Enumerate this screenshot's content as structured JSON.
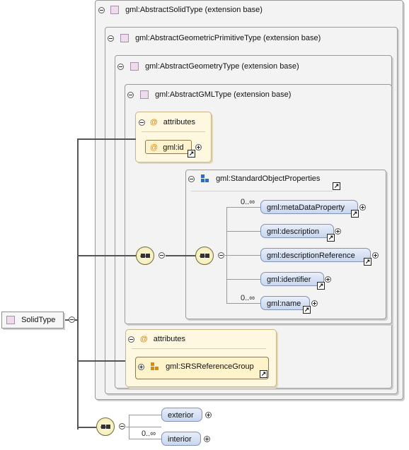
{
  "frames": {
    "solid": "gml:AbstractSolidType (extension base)",
    "primitive": "gml:AbstractGeometricPrimitiveType (extension base)",
    "geometry": "gml:AbstractGeometryType (extension base)",
    "gml": "gml:AbstractGMLType (extension base)"
  },
  "attributes_label": "attributes",
  "gml_id": "gml:id",
  "standard_object_properties": "gml:StandardObjectProperties",
  "properties": [
    {
      "name": "gml:metaDataProperty",
      "card": "0..∞"
    },
    {
      "name": "gml:description",
      "card": ""
    },
    {
      "name": "gml:descriptionReference",
      "card": ""
    },
    {
      "name": "gml:identifier",
      "card": ""
    },
    {
      "name": "gml:name",
      "card": "0..∞"
    }
  ],
  "attributes2_label": "attributes",
  "srs_group": "gml:SRSReferenceGroup",
  "root": "SolidType",
  "children": [
    {
      "name": "exterior",
      "card": ""
    },
    {
      "name": "interior",
      "card": "0..∞"
    }
  ],
  "colors": {
    "type_fill": "#ecdcec",
    "attr_fill": "#fff8e0",
    "element_fill": "#c8d6ef",
    "accent": "#e08a00",
    "group_blue": "#2a6ebf"
  }
}
